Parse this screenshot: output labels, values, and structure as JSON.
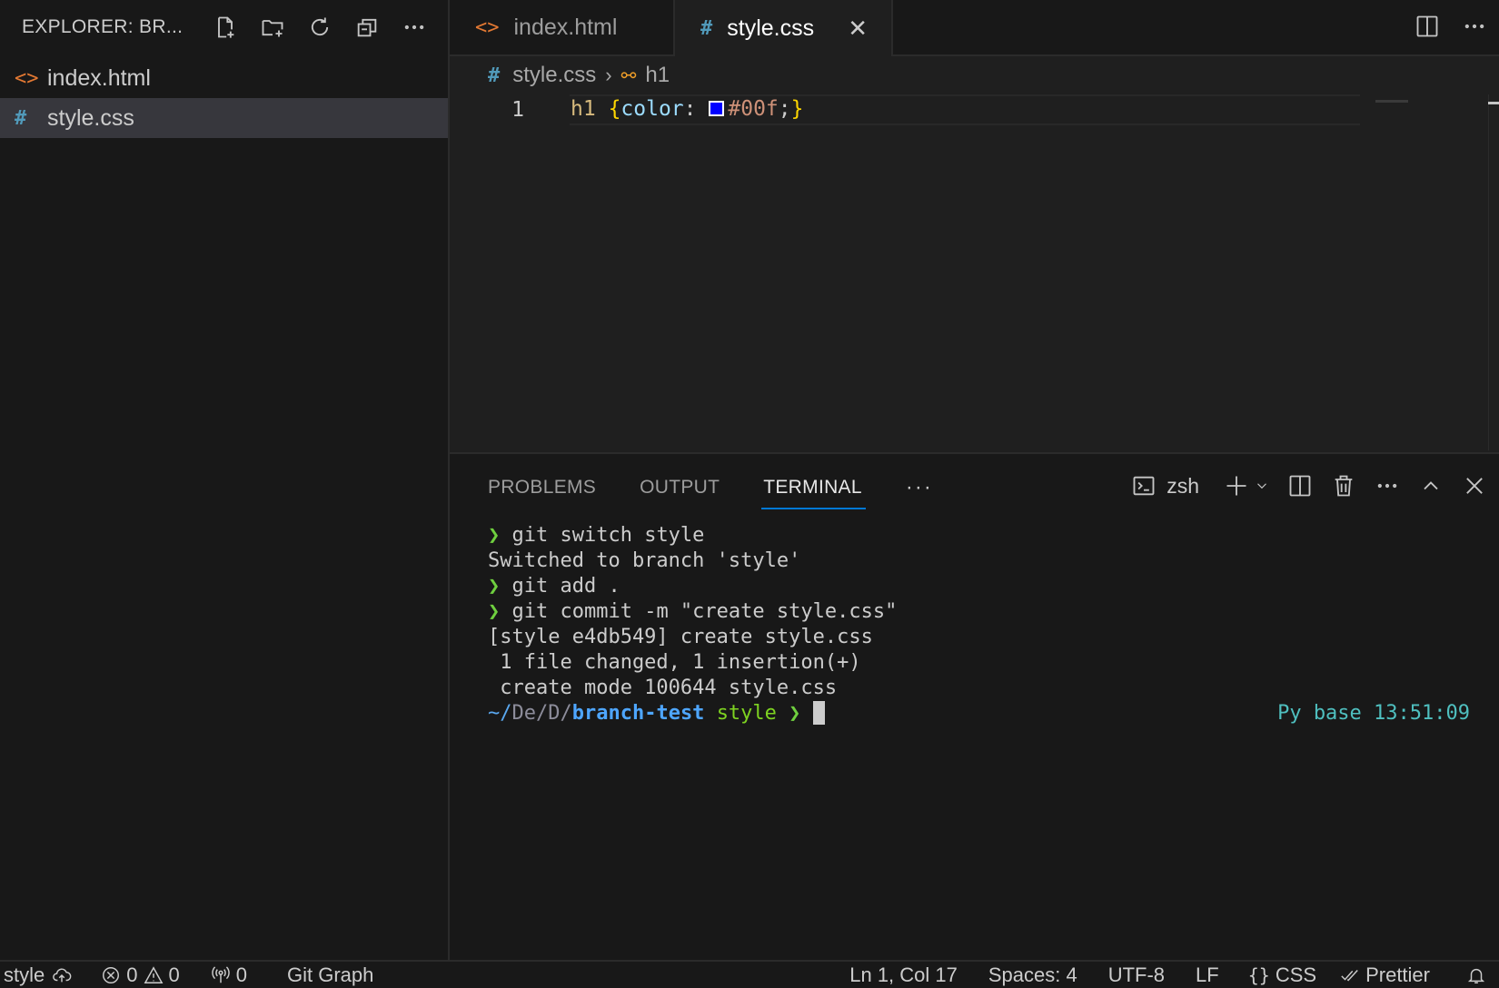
{
  "sidebar": {
    "title": "EXPLORER: BR...",
    "header_icons": [
      "new-file-icon",
      "new-folder-icon",
      "refresh-icon",
      "collapse-folders-icon",
      "more-icon"
    ],
    "files": [
      {
        "name": "index.html",
        "icon": "html-file-icon",
        "glyph": "<>"
      },
      {
        "name": "style.css",
        "icon": "css-file-icon",
        "glyph": "#",
        "selected": true
      }
    ]
  },
  "editor": {
    "tabs": [
      {
        "label": "index.html",
        "glyph": "<>",
        "active": false
      },
      {
        "label": "style.css",
        "glyph": "#",
        "active": true,
        "close": "✕"
      }
    ],
    "breadcrumb": {
      "file": "style.css",
      "file_glyph": "#",
      "symbol": "h1"
    },
    "lines": [
      {
        "number": "1",
        "selector": "h1",
        "open": "{",
        "property": "color",
        "colon": ":",
        "value": "#00f",
        "semi": ";",
        "close": "}",
        "swatch_color": "#0000ff"
      }
    ]
  },
  "panel": {
    "tabs": [
      "PROBLEMS",
      "OUTPUT",
      "TERMINAL"
    ],
    "active_tab": "TERMINAL",
    "more": "···",
    "shell": "zsh",
    "terminal": {
      "prompt_symbol": "❯",
      "lines": [
        {
          "type": "cmd",
          "text": "git switch style"
        },
        {
          "type": "out",
          "text": "Switched to branch 'style'"
        },
        {
          "type": "cmd",
          "text": "git add ."
        },
        {
          "type": "cmd",
          "text": "git commit -m \"create style.css\""
        },
        {
          "type": "out",
          "text": "[style e4db549] create style.css"
        },
        {
          "type": "out",
          "text": " 1 file changed, 1 insertion(+)"
        },
        {
          "type": "out",
          "text": " create mode 100644 style.css"
        }
      ],
      "prompt": {
        "tilde": "~/",
        "dim_path": "De/D/",
        "dir": "branch-test",
        "branch": "style",
        "arrow": "❯"
      },
      "right_prompt": "Py base 13:51:09"
    }
  },
  "statusbar": {
    "branch": "style",
    "errors": "0",
    "warnings": "0",
    "ports": "0",
    "git_graph": "Git Graph",
    "position": "Ln 1, Col 17",
    "spaces": "Spaces: 4",
    "encoding": "UTF-8",
    "eol": "LF",
    "language": "CSS",
    "formatter": "Prettier"
  },
  "colors": {
    "accent": "#0078d4",
    "html_icon": "#e37933",
    "css_icon": "#519aba",
    "prompt_green": "#6fcf3f"
  }
}
